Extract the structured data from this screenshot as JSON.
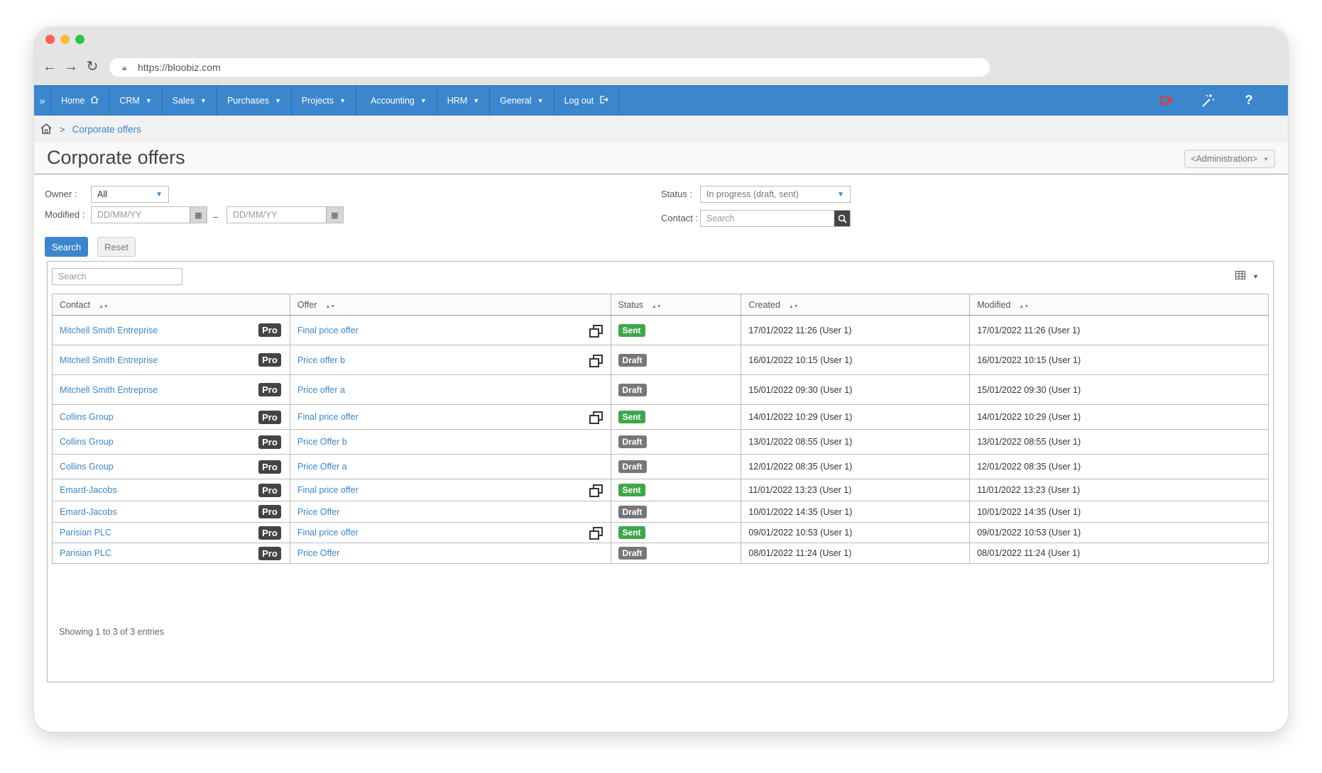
{
  "browser": {
    "url": "https://bloobiz.com"
  },
  "nav": {
    "items": [
      {
        "label": "Home",
        "caret": false
      },
      {
        "label": "CRM",
        "caret": true
      },
      {
        "label": "Sales",
        "caret": true
      },
      {
        "label": "Purchases",
        "caret": true
      },
      {
        "label": "Projects",
        "caret": true
      },
      {
        "label": "Accounting",
        "caret": true
      },
      {
        "label": "HRM",
        "caret": true
      },
      {
        "label": "General",
        "caret": true
      },
      {
        "label": "Log out",
        "caret": false
      }
    ],
    "right_icons": [
      "video-camera-icon",
      "magic-wand-icon",
      "help-icon"
    ]
  },
  "breadcrumb": {
    "current": "Corporate offers"
  },
  "page": {
    "title": "Corporate offers",
    "admin_label": "<Administration>"
  },
  "filters": {
    "owner_label": "Owner :",
    "owner_value": "All",
    "modified_label": "Modified :",
    "date_placeholder": "DD/MM/YY",
    "date_sep": "–",
    "status_label": "Status :",
    "status_value": "In progress (draft, sent)",
    "contact_label": "Contact :",
    "contact_placeholder": "Search",
    "search_button": "Search",
    "reset_button": "Reset"
  },
  "table": {
    "search_placeholder": "Search",
    "columns": [
      "Contact",
      "Offer",
      "Status",
      "Created",
      "Modified"
    ],
    "rows": [
      {
        "contact": "Mitchell Smith Entreprise",
        "badge": "Pro",
        "offer": "Final price offer",
        "copy": true,
        "status": "Sent",
        "created": "17/01/2022 11:26 (User 1)",
        "modified": "17/01/2022 11:26 (User 1)"
      },
      {
        "contact": "Mitchell Smith Entreprise",
        "badge": "Pro",
        "offer": "Price offer b",
        "copy": true,
        "status": "Draft",
        "created": "16/01/2022 10:15 (User 1)",
        "modified": "16/01/2022 10:15 (User 1)"
      },
      {
        "contact": "Mitchell Smith Entreprise",
        "badge": "Pro",
        "offer": "Price offer a",
        "copy": false,
        "status": "Draft",
        "created": "15/01/2022 09:30 (User 1)",
        "modified": "15/01/2022 09:30 (User 1)"
      },
      {
        "contact": "Collins Group",
        "badge": "Pro",
        "offer": "Final price offer",
        "copy": true,
        "status": "Sent",
        "created": "14/01/2022 10:29 (User 1)",
        "modified": "14/01/2022 10:29 (User 1)"
      },
      {
        "contact": "Collins Group",
        "badge": "Pro",
        "offer": "Price Offer b",
        "copy": false,
        "status": "Draft",
        "created": "13/01/2022 08:55 (User 1)",
        "modified": "13/01/2022 08:55 (User 1)"
      },
      {
        "contact": "Collins Group",
        "badge": "Pro",
        "offer": "Price Offer a",
        "copy": false,
        "status": "Draft",
        "created": "12/01/2022 08:35 (User 1)",
        "modified": "12/01/2022 08:35 (User 1)"
      },
      {
        "contact": "Emard-Jacobs",
        "badge": "Pro",
        "offer": "Final price offer",
        "copy": true,
        "status": "Sent",
        "created": "11/01/2022 13:23 (User 1)",
        "modified": "11/01/2022 13:23 (User 1)"
      },
      {
        "contact": "Emard-Jacobs",
        "badge": "Pro",
        "offer": "Price Offer",
        "copy": false,
        "status": "Draft",
        "created": "10/01/2022 14:35 (User 1)",
        "modified": "10/01/2022 14:35 (User 1)"
      },
      {
        "contact": "Parisian PLC",
        "badge": "Pro",
        "offer": "Final price offer",
        "copy": true,
        "status": "Sent",
        "created": "09/01/2022 10:53 (User 1)",
        "modified": "09/01/2022 10:53 (User 1)"
      },
      {
        "contact": "Parisian PLC",
        "badge": "Pro",
        "offer": "Price Offer",
        "copy": false,
        "status": "Draft",
        "created": "08/01/2022 11:24 (User 1)",
        "modified": "08/01/2022 11:24 (User 1)"
      }
    ],
    "entries_text": "Showing 1 to 3 of 3 entries"
  },
  "colors": {
    "accent": "#3b86cc",
    "sent": "#3fa64a",
    "draft": "#777777"
  }
}
